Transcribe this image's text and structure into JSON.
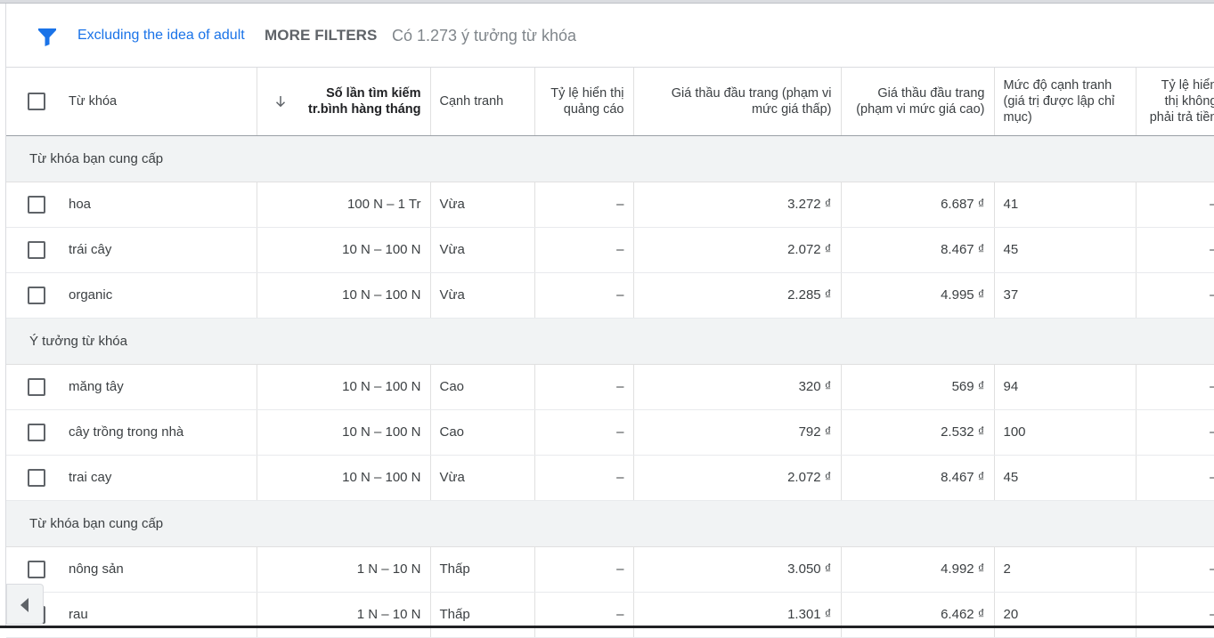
{
  "filter_bar": {
    "filter_chip": "Excluding the idea of adult",
    "more_filters": "MORE FILTERS",
    "count": "Có 1.273 ý tưởng từ khóa"
  },
  "columns": {
    "keyword": "Từ khóa",
    "searches": "Số lần tìm kiếm tr.bình hàng tháng",
    "competition": "Cạnh tranh",
    "impression_share": "Tỷ lệ hiển thị quảng cáo",
    "bid_low": "Giá thầu đầu trang (phạm vi mức giá thấp)",
    "bid_high": "Giá thầu đầu trang (phạm vi mức giá cao)",
    "comp_index": "Mức độ cạnh tranh (giá trị được lập chỉ mục)",
    "organic_share": "Tỷ lệ hiển thị không phải trả tiền"
  },
  "groups": [
    {
      "label": "Từ khóa bạn cung cấp",
      "rows": [
        {
          "keyword": "hoa",
          "searches": "100 N – 1 Tr",
          "competition": "Vừa",
          "impression": "–",
          "bid_low": "3.272 ₫",
          "bid_high": "6.687 ₫",
          "index": "41",
          "organic": "–"
        },
        {
          "keyword": "trái cây",
          "searches": "10 N – 100 N",
          "competition": "Vừa",
          "impression": "–",
          "bid_low": "2.072 ₫",
          "bid_high": "8.467 ₫",
          "index": "45",
          "organic": "–"
        },
        {
          "keyword": "organic",
          "searches": "10 N – 100 N",
          "competition": "Vừa",
          "impression": "–",
          "bid_low": "2.285 ₫",
          "bid_high": "4.995 ₫",
          "index": "37",
          "organic": "–"
        }
      ]
    },
    {
      "label": "Ý tưởng từ khóa",
      "rows": [
        {
          "keyword": "măng tây",
          "searches": "10 N – 100 N",
          "competition": "Cao",
          "impression": "–",
          "bid_low": "320 ₫",
          "bid_high": "569 ₫",
          "index": "94",
          "organic": "–"
        },
        {
          "keyword": "cây trồng trong nhà",
          "searches": "10 N – 100 N",
          "competition": "Cao",
          "impression": "–",
          "bid_low": "792 ₫",
          "bid_high": "2.532 ₫",
          "index": "100",
          "organic": "–"
        },
        {
          "keyword": "trai cay",
          "searches": "10 N – 100 N",
          "competition": "Vừa",
          "impression": "–",
          "bid_low": "2.072 ₫",
          "bid_high": "8.467 ₫",
          "index": "45",
          "organic": "–"
        }
      ]
    },
    {
      "label": "Từ khóa bạn cung cấp",
      "rows": [
        {
          "keyword": "nông sản",
          "searches": "1 N – 10 N",
          "competition": "Thấp",
          "impression": "–",
          "bid_low": "3.050 ₫",
          "bid_high": "4.992 ₫",
          "index": "2",
          "organic": "–"
        },
        {
          "keyword": "rau",
          "searches": "1 N – 10 N",
          "competition": "Thấp",
          "impression": "–",
          "bid_low": "1.301 ₫",
          "bid_high": "6.462 ₫",
          "index": "20",
          "organic": "–"
        }
      ]
    }
  ],
  "colors": {
    "accent": "#1a73e8",
    "group_bg": "#f1f3f4",
    "border": "#dadce0"
  }
}
